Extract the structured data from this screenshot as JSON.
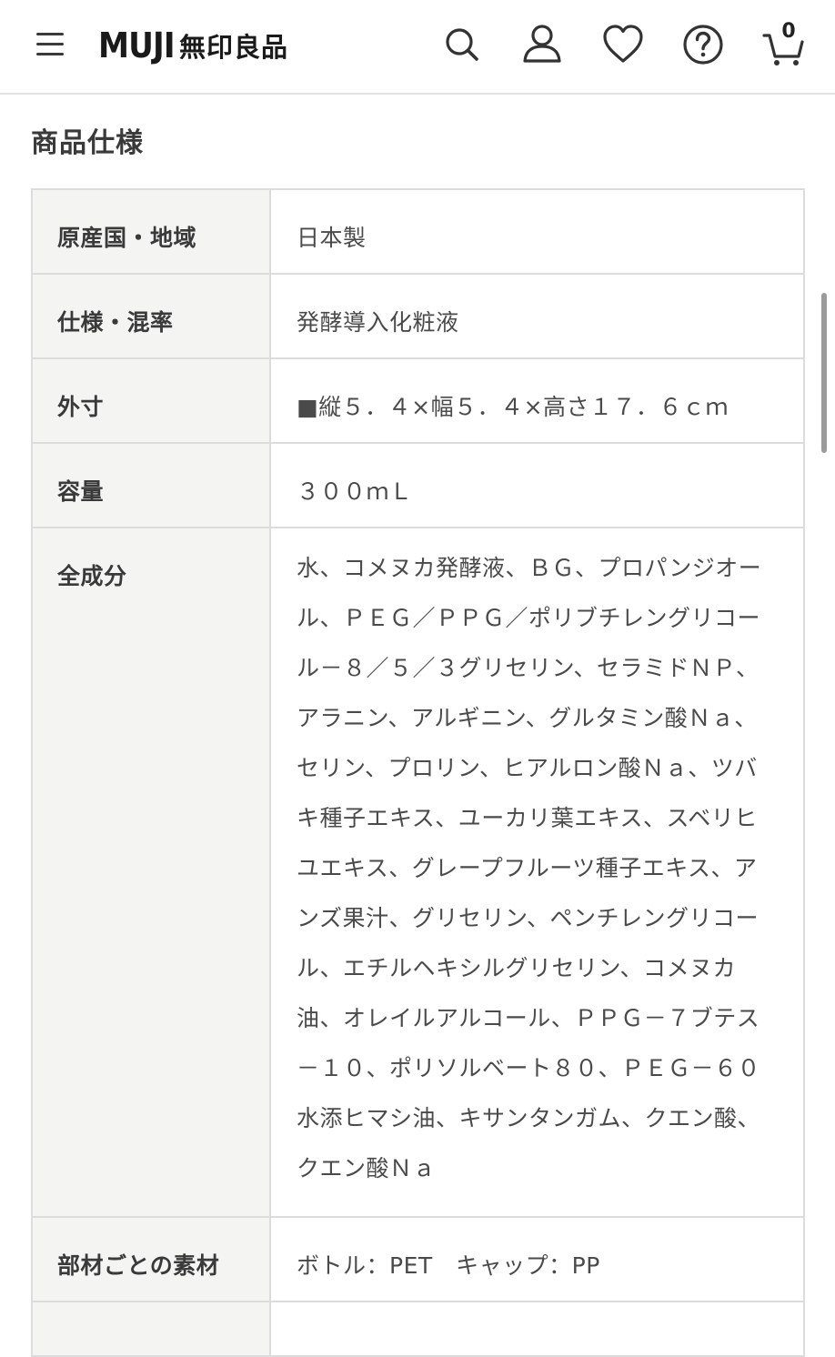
{
  "header": {
    "logo_en": "MUJI",
    "logo_jp": "無印良品",
    "cart_count": "0",
    "icons": [
      "menu-icon",
      "search-icon",
      "account-icon",
      "heart-icon",
      "help-icon",
      "cart-icon"
    ]
  },
  "section": {
    "title": "商品仕様"
  },
  "specs": [
    {
      "label": "原産国・地域",
      "value": "日本製"
    },
    {
      "label": "仕様・混率",
      "value": "発酵導入化粧液"
    },
    {
      "label": "外寸",
      "value": "■縦５．４×幅５．４×高さ１７．６ｃｍ"
    },
    {
      "label": "容量",
      "value": "３００ｍＬ"
    },
    {
      "label": "全成分",
      "value": "水、コメヌカ発酵液、ＢＧ、プロパンジオール、ＰＥＧ／ＰＰＧ／ポリブチレングリコール－８／５／３グリセリン、セラミドＮＰ、アラニン、アルギニン、グルタミン酸Ｎａ、セリン、プロリン、ヒアルロン酸Ｎａ、ツバキ種子エキス、ユーカリ葉エキス、スベリヒユエキス、グレープフルーツ種子エキス、アンズ果汁、グリセリン、ペンチレングリコール、エチルヘキシルグリセリン、コメヌカ油、オレイルアルコール、ＰＰＧ－７ブテス－１０、ポリソルベート８０、ＰＥＧ－６０水添ヒマシ油、キサンタンガム、クエン酸、クエン酸Ｎａ"
    },
    {
      "label": "部材ごとの素材",
      "value": "ボトル：PET　キャップ：PP"
    },
    {
      "label": "",
      "value": ""
    }
  ],
  "ingredient_lines": [
    "水、コメヌカ発酵液、ＢＧ、プロパンジオー",
    "ル、ＰＥＧ／ＰＰＧ／ポリブチレングリコー",
    "ル－８／５／３グリセリン、セラミドＮＰ、",
    "アラニン、アルギニン、グルタミン酸Ｎａ、",
    "セリン、プロリン、ヒアルロン酸Ｎａ、ツバ",
    "キ種子エキス、ユーカリ葉エキス、スベリヒ",
    "ユエキス、グレープフルーツ種子エキス、ア",
    "ンズ果汁、グリセリン、ペンチレングリコー",
    "ル、エチルヘキシルグリセリン、コメヌカ",
    "油、オレイルアルコール、ＰＰＧ－７ブテス",
    "－１０、ポリソルベート８０、ＰＥＧ－６０",
    "水添ヒマシ油、キサンタンガム、クエン酸、",
    "クエン酸Ｎａ"
  ]
}
